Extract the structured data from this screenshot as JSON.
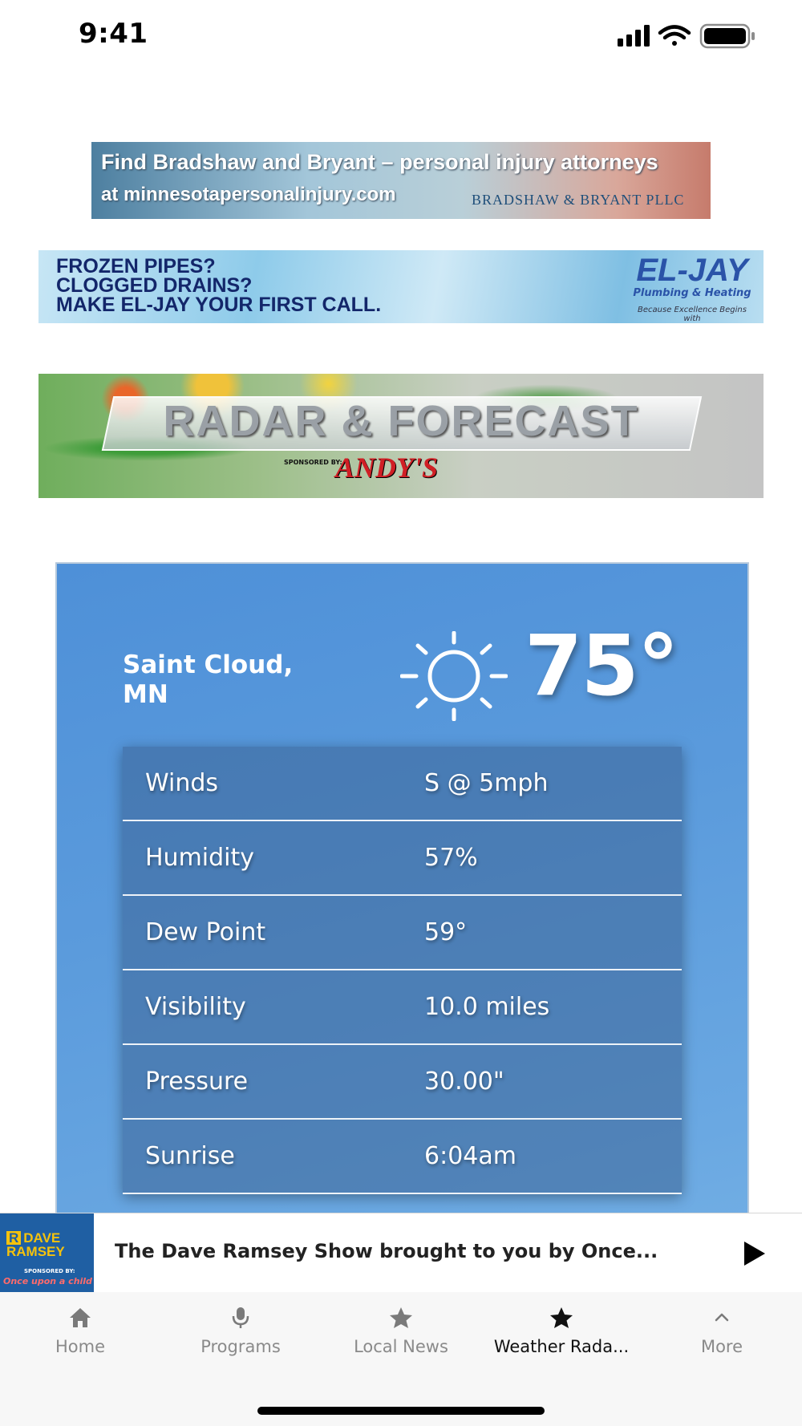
{
  "status_bar": {
    "time": "9:41"
  },
  "ads": {
    "bradshaw": {
      "line1": "Find Bradshaw and Bryant – personal injury attorneys",
      "line2": "at minnesotapersonalinjury.com",
      "brand": "BRADSHAW & BRYANT PLLC"
    },
    "eljay": {
      "line1": "FROZEN PIPES?",
      "line2": "CLOGGED DRAINS?",
      "line3": "MAKE EL-JAY YOUR FIRST CALL.",
      "logo": "EL-JAY",
      "logo_sub": "Plumbing & Heating",
      "tagline": "Because Excellence Begins with"
    },
    "radar": {
      "title": "RADAR & FORECAST",
      "sponsor_label": "SPONSORED BY:",
      "sponsor": "ANDY'S"
    }
  },
  "weather": {
    "location": "Saint Cloud, MN",
    "temperature": "75°",
    "condition_icon": "sun-icon",
    "conditions": [
      {
        "label": "Winds",
        "value": "S @ 5mph"
      },
      {
        "label": "Humidity",
        "value": "57%"
      },
      {
        "label": "Dew Point",
        "value": "59°"
      },
      {
        "label": "Visibility",
        "value": "10.0 miles"
      },
      {
        "label": "Pressure",
        "value": "30.00\""
      },
      {
        "label": "Sunrise",
        "value": "6:04am"
      }
    ]
  },
  "now_playing": {
    "art_title": "DAVE RAMSEY",
    "art_sponsor": "SPONSORED BY:",
    "art_brand": "Once upon a child",
    "title": "The Dave Ramsey Show brought to you by Once..."
  },
  "tabs": [
    {
      "label": "Home",
      "icon": "home-icon",
      "active": false
    },
    {
      "label": "Programs",
      "icon": "microphone-icon",
      "active": false
    },
    {
      "label": "Local News",
      "icon": "star-icon",
      "active": false
    },
    {
      "label": "Weather Rada...",
      "icon": "star-icon",
      "active": true
    },
    {
      "label": "More",
      "icon": "chevron-up-icon",
      "active": false
    }
  ],
  "colors": {
    "card_blue": "#5b9bdc",
    "tab_active": "#111111",
    "tab_inactive": "#8a8a8a"
  }
}
